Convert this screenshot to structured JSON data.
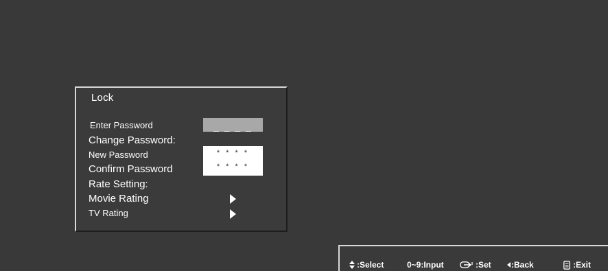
{
  "lock_menu": {
    "title": "Lock",
    "enter_password_label": "Enter Password",
    "enter_password_value": "_ _ _ _",
    "change_password_label": "Change Password:",
    "new_password_label": "New Password",
    "new_password_value": "* * * *",
    "confirm_password_label": "Confirm Password",
    "confirm_password_value": "* * * *",
    "rate_setting_label": "Rate Setting:",
    "movie_rating_label": "Movie Rating",
    "tv_rating_label": "TV Rating",
    "movie_rating_icon": "arrow-right-icon",
    "tv_rating_icon": "arrow-right-icon"
  },
  "help_bar": {
    "select_icon": "up-down-arrows-icon",
    "select_label": ":Select",
    "input_label": "0~9:Input",
    "set_icon": "enter-key-icon",
    "set_label": ":Set",
    "back_icon": "left-arrow-icon",
    "back_label": ":Back",
    "exit_icon": "remote-menu-icon",
    "exit_label": ":Exit"
  },
  "colors": {
    "background": "#393939",
    "panel_border_light": "#d8d8d8",
    "password_field_gray": "#a8a8a8",
    "password_field_white": "#ffffff",
    "text": "#ffffff"
  }
}
